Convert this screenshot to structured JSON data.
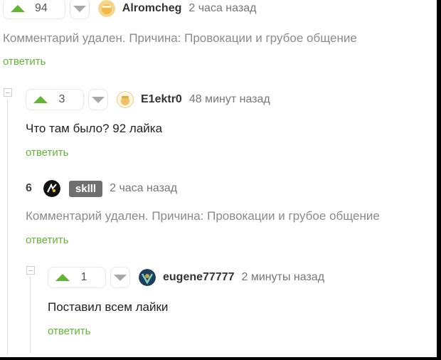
{
  "reply_label": "ответить",
  "comment1": {
    "rating": "94",
    "username": "Alromcheg",
    "time": "2 часа назад",
    "text": "Комментарий удален. Причина: Провокации и грубое общение"
  },
  "comment2": {
    "rating": "3",
    "username": "E1ektr0",
    "time": "48 минут назад",
    "text": "Что там было? 92 лайка"
  },
  "comment3": {
    "rating": "6",
    "username": "sklll",
    "time": "2 часа назад",
    "text": "Комментарий удален. Причина: Провокации и грубое общение"
  },
  "comment4": {
    "rating": "1",
    "username": "eugene77777",
    "time": "2 минуты назад",
    "text": "Поставил всем лайки"
  },
  "colors": {
    "accent_green": "#62b534",
    "muted_text": "#8a8a8a",
    "badge_bg": "#6f6f6f"
  },
  "icons": [
    "upvote-icon",
    "downvote-icon",
    "collapse-icon",
    "avatar"
  ]
}
